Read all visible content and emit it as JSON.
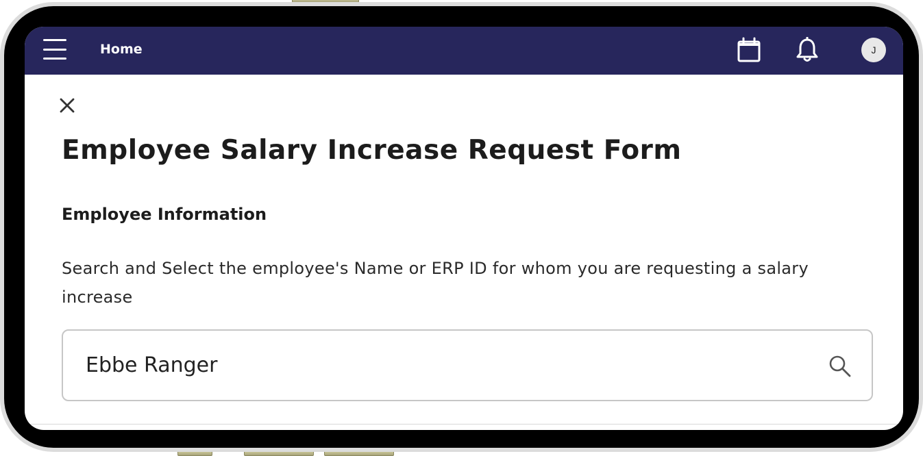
{
  "topbar": {
    "home_label": "Home",
    "avatar_initial": "J",
    "background": "#27265c"
  },
  "icons": {
    "menu": "hamburger-menu-icon",
    "calendar": "calendar-icon",
    "notifications": "bell-icon",
    "close": "close-icon",
    "search": "search-icon"
  },
  "form": {
    "title": "Employee Salary Increase Request Form",
    "section_title": "Employee Information",
    "instructions": "Search and Select the employee's Name or ERP ID for whom you are requesting a salary increase",
    "search_value": "Ebbe Ranger"
  }
}
